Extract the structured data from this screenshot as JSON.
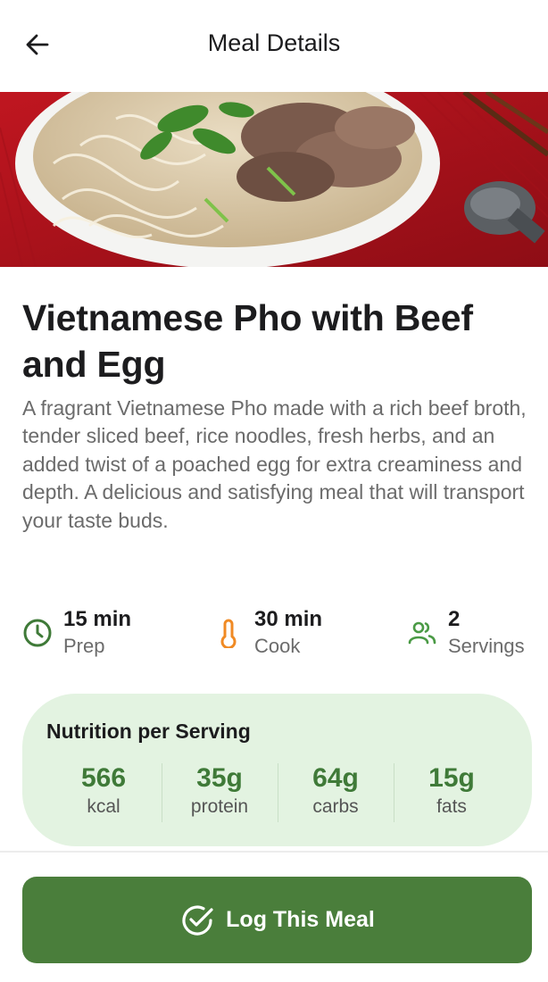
{
  "header": {
    "title": "Meal Details",
    "back_icon": "arrow-left-icon"
  },
  "hero": {
    "image": "pho-bowl-photo"
  },
  "meal": {
    "title": "Vietnamese Pho with Beef and Egg",
    "description": "A fragrant Vietnamese Pho made with a rich beef broth, tender sliced beef, rice noodles, fresh herbs, and an added twist of a poached egg for extra creaminess and depth. A delicious and satisfying meal that will transport your taste buds."
  },
  "stats": [
    {
      "icon": "clock-icon",
      "value": "15 min",
      "label": "Prep",
      "color": "#3f7a38"
    },
    {
      "icon": "thermometer-icon",
      "value": "30 min",
      "label": "Cook",
      "color": "#f08a24"
    },
    {
      "icon": "users-icon",
      "value": "2",
      "label": "Servings",
      "color": "#4a9a45"
    }
  ],
  "nutrition": {
    "title": "Nutrition per Serving",
    "items": [
      {
        "value": "566",
        "label": "kcal"
      },
      {
        "value": "35g",
        "label": "protein"
      },
      {
        "value": "64g",
        "label": "carbs"
      },
      {
        "value": "15g",
        "label": "fats"
      }
    ]
  },
  "actions": {
    "log_label": "Log This Meal",
    "log_icon": "check-circle-icon"
  },
  "colors": {
    "primary": "#4a7e3b",
    "nutrition_bg": "#e3f3e1",
    "nutrition_value": "#3f7a38"
  }
}
